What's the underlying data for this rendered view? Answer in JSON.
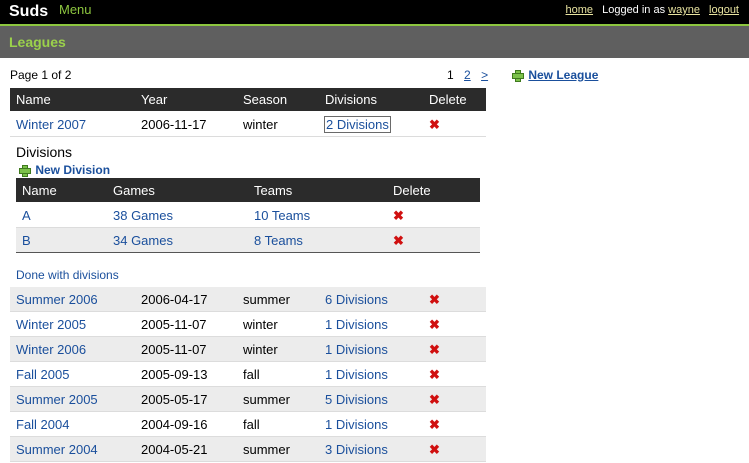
{
  "header": {
    "brand": "Suds",
    "menu": "Menu",
    "home": "home",
    "logged_in_as": "Logged in as",
    "user": "wayne",
    "logout": "logout"
  },
  "section_title": "Leagues",
  "pagination": {
    "info": "Page 1 of 2",
    "current": "1",
    "page2": "2",
    "next": ">"
  },
  "new_league": "New League",
  "columns": {
    "name": "Name",
    "year": "Year",
    "season": "Season",
    "divisions": "Divisions",
    "delete": "Delete"
  },
  "leagues": [
    {
      "name": "Winter 2007",
      "year": "2006-11-17",
      "season": "winter",
      "divisions": "2 Divisions"
    },
    {
      "name": "Summer 2006",
      "year": "2006-04-17",
      "season": "summer",
      "divisions": "6 Divisions"
    },
    {
      "name": "Winter 2005",
      "year": "2005-11-07",
      "season": "winter",
      "divisions": "1 Divisions"
    },
    {
      "name": "Winter 2006",
      "year": "2005-11-07",
      "season": "winter",
      "divisions": "1 Divisions"
    },
    {
      "name": "Fall 2005",
      "year": "2005-09-13",
      "season": "fall",
      "divisions": "1 Divisions"
    },
    {
      "name": "Summer 2005",
      "year": "2005-05-17",
      "season": "summer",
      "divisions": "5 Divisions"
    },
    {
      "name": "Fall 2004",
      "year": "2004-09-16",
      "season": "fall",
      "divisions": "1 Divisions"
    },
    {
      "name": "Summer 2004",
      "year": "2004-05-21",
      "season": "summer",
      "divisions": "3 Divisions"
    }
  ],
  "divisions_panel": {
    "title": "Divisions",
    "new_division": "New Division",
    "columns": {
      "name": "Name",
      "games": "Games",
      "teams": "Teams",
      "delete": "Delete"
    },
    "rows": [
      {
        "name": "A",
        "games": "38 Games",
        "teams": "10 Teams"
      },
      {
        "name": "B",
        "games": "34 Games",
        "teams": "8 Teams"
      }
    ],
    "done": "Done with divisions"
  },
  "icons": {
    "add": "plus-icon",
    "delete": "delete-x-icon"
  },
  "colors": {
    "accent": "#8dc63f",
    "link": "#1a4f9c",
    "delete": "#d01010"
  }
}
